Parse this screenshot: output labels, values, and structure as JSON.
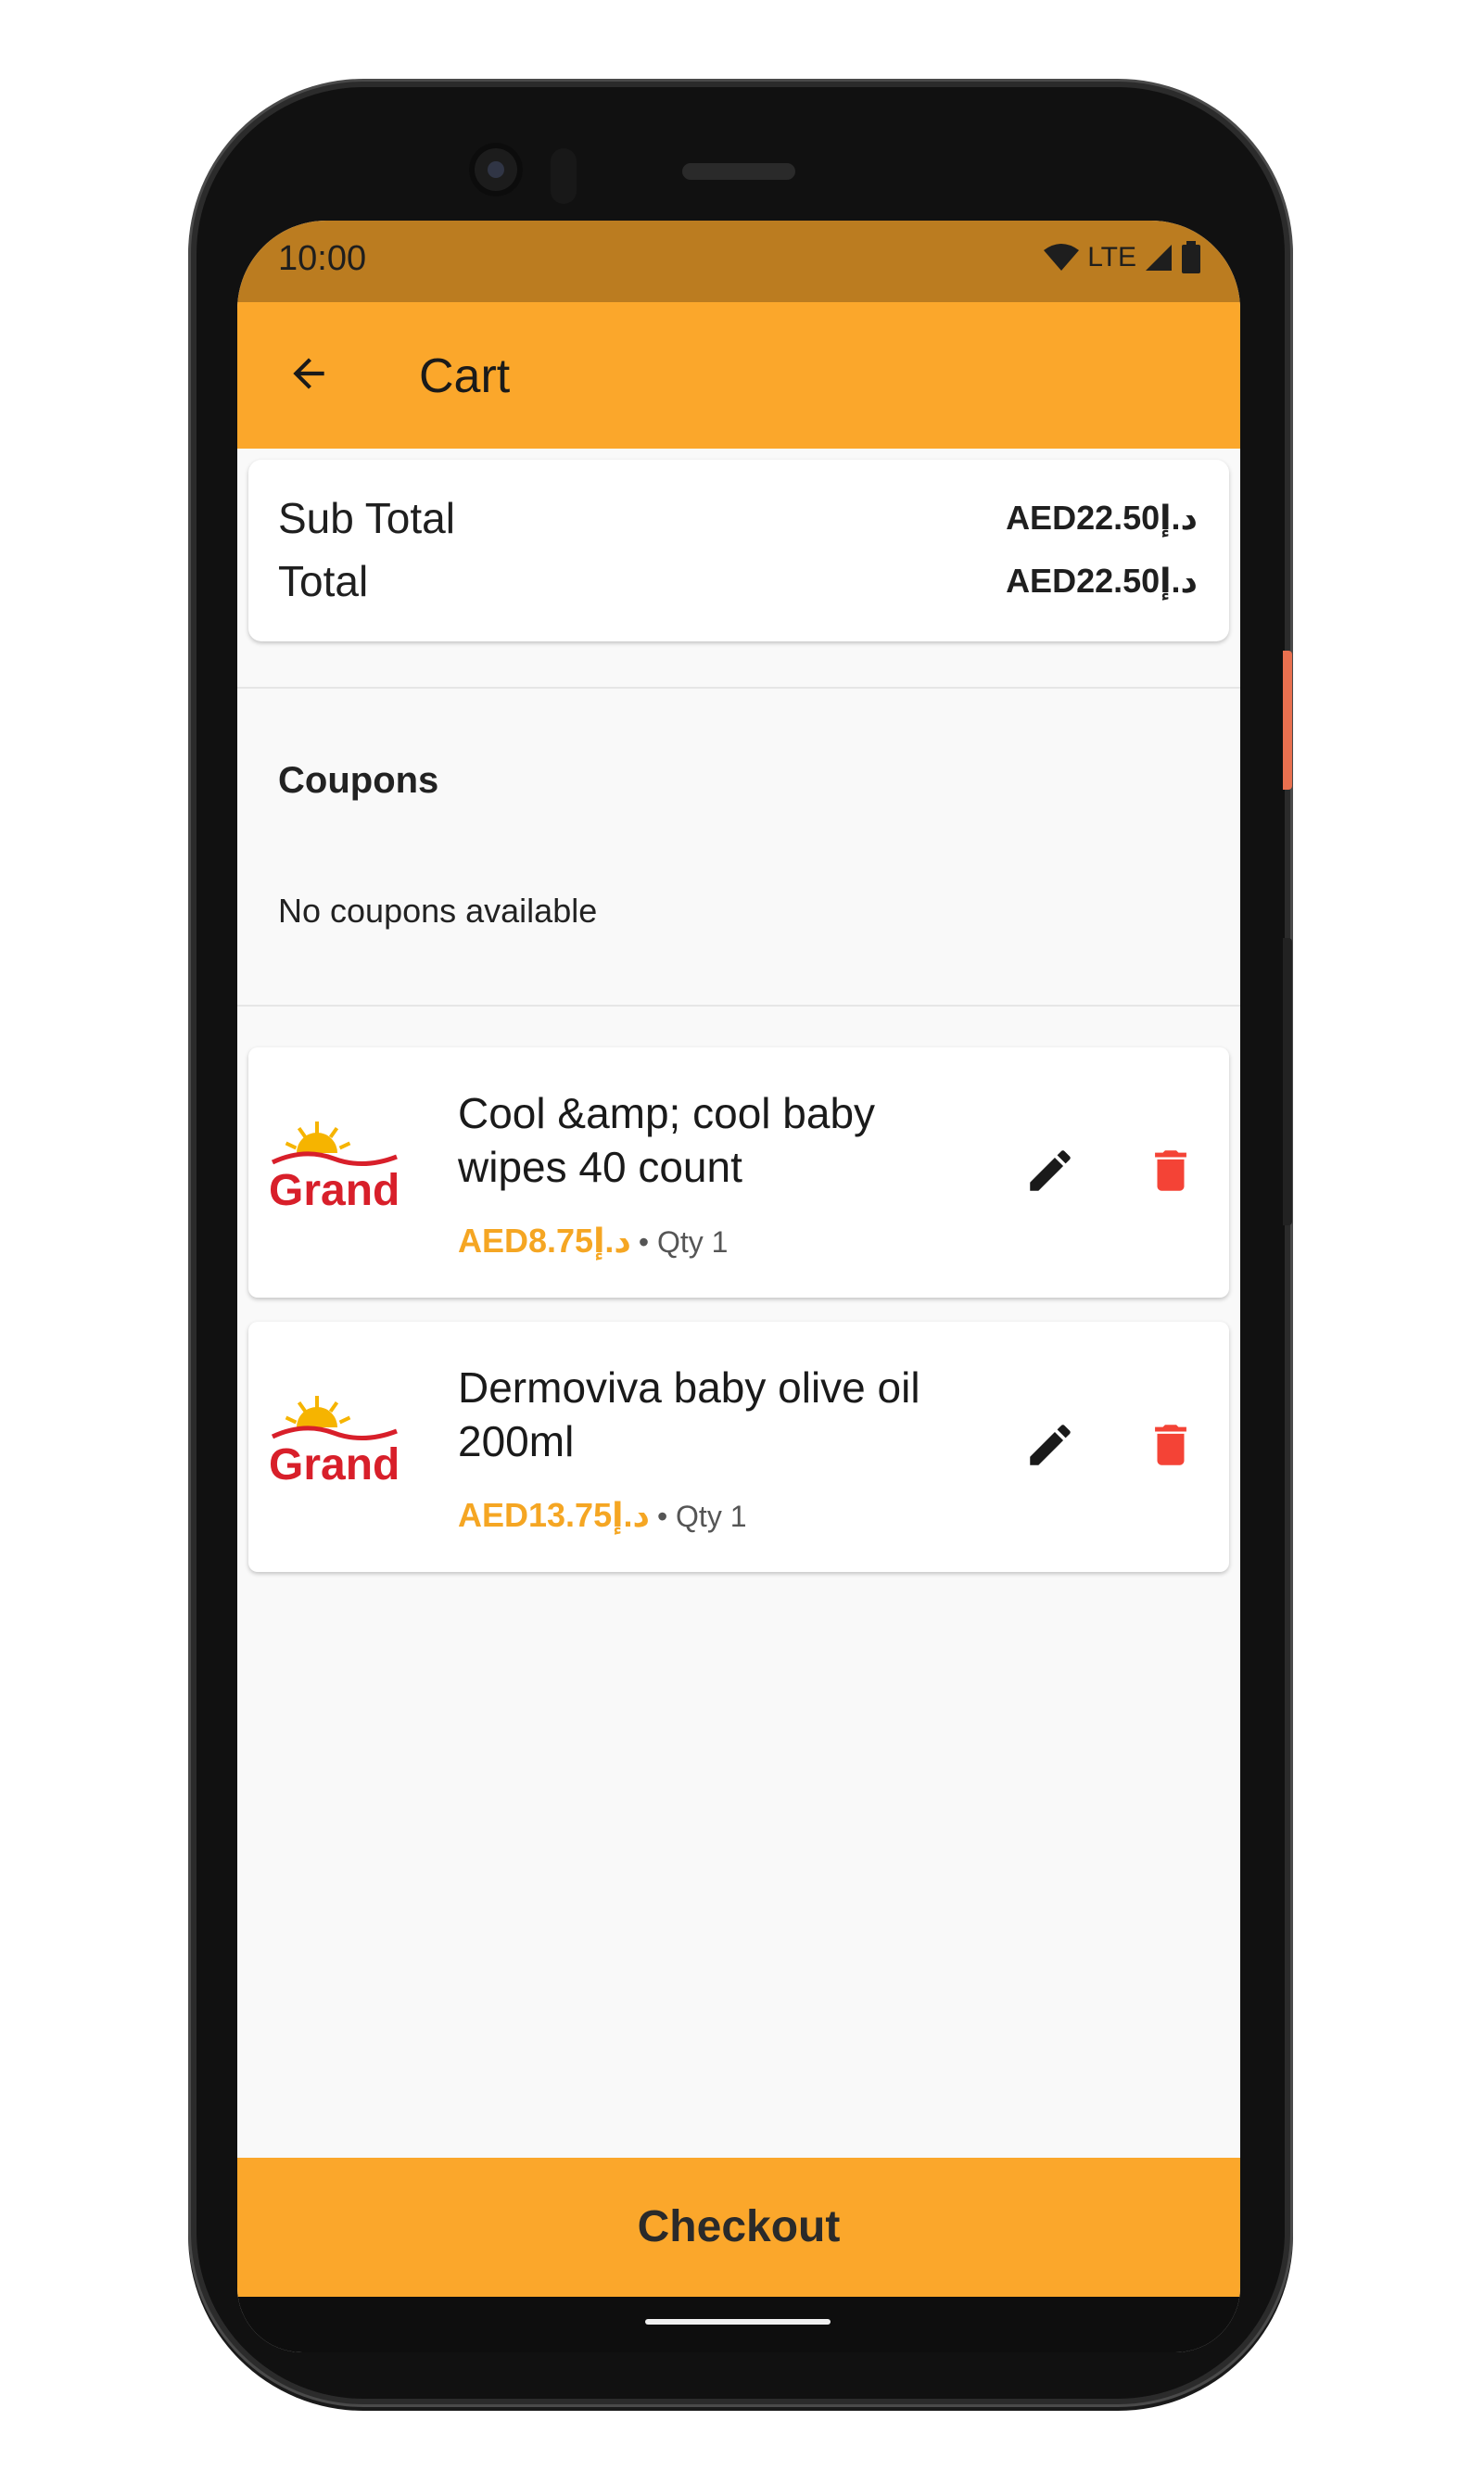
{
  "status_bar": {
    "time": "10:00",
    "network": "LTE"
  },
  "app_bar": {
    "title": "Cart",
    "back_icon": "arrow-left-icon"
  },
  "totals": {
    "sub_total_label": "Sub Total",
    "sub_total_value": "AED22.50د.إ",
    "total_label": "Total",
    "total_value": "AED22.50د.إ"
  },
  "coupons": {
    "heading": "Coupons",
    "empty_text": "No coupons available"
  },
  "cart_items": [
    {
      "name": "Cool &amp; cool baby wipes 40 count",
      "price": "AED8.75د.إ",
      "qty": "• Qty 1",
      "logo_text": "Grand"
    },
    {
      "name": "Dermoviva baby olive oil 200ml",
      "price": "AED13.75د.إ",
      "qty": "• Qty 1",
      "logo_text": "Grand"
    }
  ],
  "checkout": {
    "label": "Checkout"
  },
  "colors": {
    "accent": "#fba72b",
    "status_bar": "#bb7c20",
    "price": "#f5a623",
    "delete": "#f44336",
    "logo_red": "#d81f2a",
    "logo_yellow": "#f6b400"
  },
  "icons": {
    "edit": "pencil-icon",
    "delete": "trash-icon",
    "wifi": "wifi-icon",
    "signal": "signal-icon",
    "battery": "battery-icon"
  }
}
